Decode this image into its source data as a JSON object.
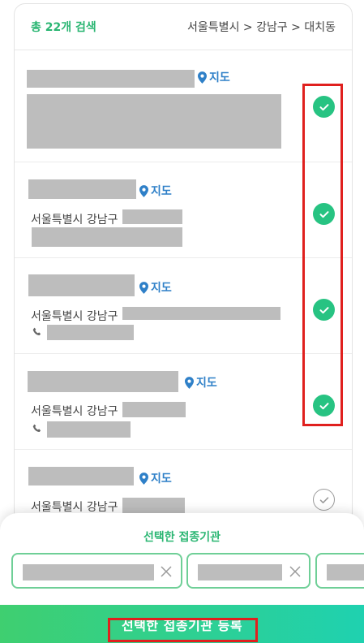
{
  "header": {
    "total_label": "총 22개 검색",
    "location_label": "서울특별시 > 강남구 > 대치동"
  },
  "map_label": "지도",
  "items": [
    {
      "address_prefix": "",
      "has_phone": false,
      "selected": true
    },
    {
      "address_prefix": "서울특별시 강남구",
      "has_phone": false,
      "selected": true
    },
    {
      "address_prefix": "서울특별시 강남구",
      "has_phone": true,
      "selected": true
    },
    {
      "address_prefix": "서울특별시 강남구",
      "has_phone": true,
      "selected": true
    },
    {
      "address_prefix": "서울특별시 강남구",
      "has_phone": false,
      "selected": false
    }
  ],
  "sheet": {
    "title": "선택한 접종기관"
  },
  "register_button": {
    "label": "선택한 접종기관 등록"
  },
  "colors": {
    "accent_green": "#2bb673",
    "check_green": "#27c382",
    "map_blue": "#2f80c8",
    "highlight_red": "#e0201e"
  },
  "icons": [
    "map-pin-icon",
    "check-icon",
    "phone-icon",
    "close-icon"
  ]
}
